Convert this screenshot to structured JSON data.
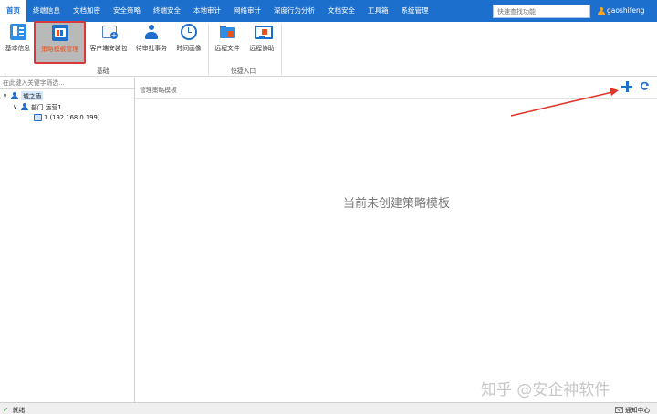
{
  "menu": {
    "items": [
      {
        "label": "首页",
        "active": true
      },
      {
        "label": "终端信息",
        "active": false
      },
      {
        "label": "文档加密",
        "active": false
      },
      {
        "label": "安全策略",
        "active": false
      },
      {
        "label": "终端安全",
        "active": false
      },
      {
        "label": "本地审计",
        "active": false
      },
      {
        "label": "网络审计",
        "active": false
      },
      {
        "label": "深度行为分析",
        "active": false
      },
      {
        "label": "文档安全",
        "active": false
      },
      {
        "label": "工具箱",
        "active": false
      },
      {
        "label": "系统管理",
        "active": false
      }
    ],
    "search_placeholder": "快速查找功能",
    "username": "gaoshifeng",
    "accent": "#1d6fce"
  },
  "ribbon": {
    "buttons": [
      {
        "label": "基本信息",
        "icon": "info-card-icon"
      },
      {
        "label": "策略模板管理",
        "icon": "policy-template-icon",
        "selected": true
      },
      {
        "label": "客户端安装包",
        "icon": "install-package-icon"
      },
      {
        "label": "待审批事务",
        "icon": "approval-user-icon"
      },
      {
        "label": "时间画像",
        "icon": "clock-icon"
      },
      {
        "label": "远程文件",
        "icon": "remote-folder-icon"
      },
      {
        "label": "远程协助",
        "icon": "remote-assist-icon"
      }
    ],
    "groups": {
      "basic": "基础",
      "quick": "快捷入口"
    }
  },
  "tree": {
    "filter_placeholder": "在此键入关键字筛选...",
    "root": "城之盾",
    "dept": "部门 运营1",
    "device": "1 (192.168.0.199)"
  },
  "main": {
    "header": "管理策略模板",
    "empty_message": "当前未创建策略模板"
  },
  "watermark": "知乎 @安企神软件",
  "status": {
    "ready": "就绪",
    "notice": "通知中心"
  },
  "annotation_color": "#e0362c"
}
